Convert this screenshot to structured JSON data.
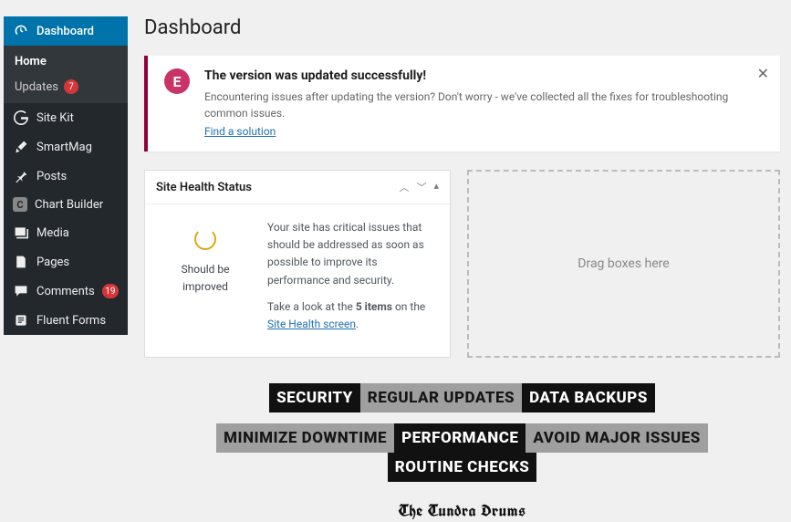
{
  "page": {
    "title": "Dashboard"
  },
  "sidebar": {
    "items": [
      {
        "label": "Dashboard",
        "icon": "dashboard"
      },
      {
        "label": "Site Kit",
        "icon": "google"
      },
      {
        "label": "SmartMag",
        "icon": "brush"
      },
      {
        "label": "Posts",
        "icon": "pin"
      },
      {
        "label": "Chart Builder",
        "icon": "chart"
      },
      {
        "label": "Media",
        "icon": "media"
      },
      {
        "label": "Pages",
        "icon": "pages"
      },
      {
        "label": "Comments",
        "icon": "comment",
        "badge": "19"
      },
      {
        "label": "Fluent Forms",
        "icon": "forms"
      }
    ],
    "sub": [
      {
        "label": "Home"
      },
      {
        "label": "Updates",
        "badge": "7"
      }
    ]
  },
  "notice": {
    "title": "The version was updated successfully!",
    "text": "Encountering issues after updating the version? Don't worry - we've collected all the fixes for troubleshooting common issues.",
    "link": "Find a solution"
  },
  "site_health": {
    "heading": "Site Health Status",
    "label": "Should be improved",
    "desc1": "Your site has critical issues that should be addressed as soon as possible to improve its performance and security.",
    "desc2a": "Take a look at the ",
    "desc2_bold": "5 items",
    "desc2b": " on the ",
    "desc2_link": "Site Health screen"
  },
  "dropzone": {
    "label": "Drag boxes here"
  },
  "tags": {
    "row1": [
      "SECURITY",
      "REGULAR UPDATES",
      "DATA BACKUPS"
    ],
    "row2": [
      "MINIMIZE DOWNTIME",
      "PERFORMANCE",
      "AVOID MAJOR ISSUES",
      "ROUTINE CHECKS"
    ]
  },
  "footer": {
    "brand": "The Tundra Drums"
  }
}
